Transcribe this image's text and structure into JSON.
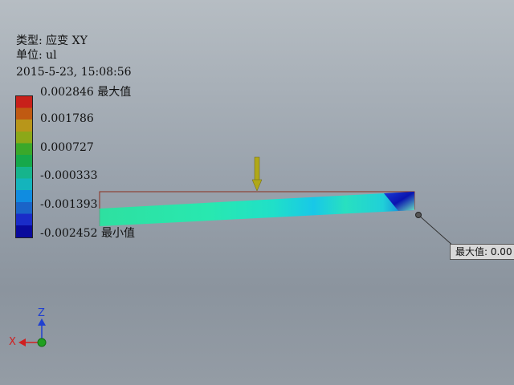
{
  "plot": {
    "type_line": "类型: 应变 XY",
    "unit_line": "单位: ul",
    "timestamp": "2015-5-23, 15:08:56"
  },
  "colorbar": {
    "labels": [
      {
        "value": "0.002846",
        "suffix": " 最大值"
      },
      {
        "value": "0.001786",
        "suffix": ""
      },
      {
        "value": "0.000727",
        "suffix": ""
      },
      {
        "value": "-0.000333",
        "suffix": ""
      },
      {
        "value": "-0.001393",
        "suffix": ""
      },
      {
        "value": "-0.002452",
        "suffix": " 最小值"
      }
    ]
  },
  "callout": {
    "label": "最大值: 0.00"
  },
  "triad": {
    "z": "Z",
    "x": "X"
  },
  "colors": {
    "load_arrow": "#b0a818",
    "outline": "#8b2e1e",
    "triad_x": "#d02020",
    "triad_z": "#2040d0",
    "triad_origin": "#20a020"
  }
}
